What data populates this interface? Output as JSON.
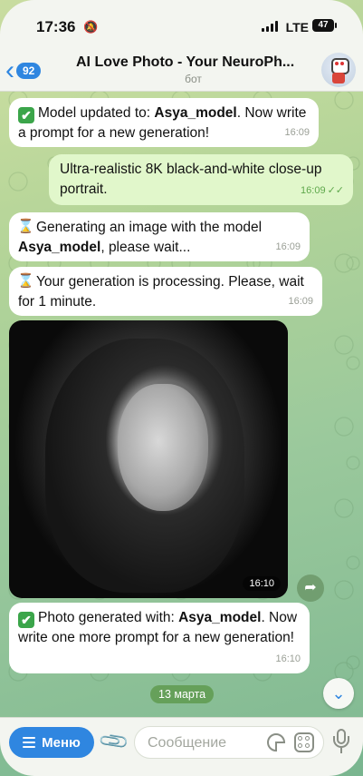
{
  "status": {
    "time": "17:36",
    "network": "LTE",
    "battery": "47"
  },
  "header": {
    "back_count": "92",
    "title": "AI Love Photo - Your NeuroPh...",
    "subtitle": "бот"
  },
  "messages": [
    {
      "type": "in",
      "emoji": "✔",
      "text_before": "Model updated to: ",
      "bold": "Asya_model",
      "text_after": ". Now write a prompt for a new generation!",
      "time": "16:09"
    },
    {
      "type": "out",
      "text": "Ultra-realistic 8K black-and-white close-up portrait.",
      "time": "16:09"
    },
    {
      "type": "in",
      "text_before": "Generating an image with the model ",
      "bold": "Asya_model",
      "text_after": ", please wait...",
      "time": "16:09"
    },
    {
      "type": "in",
      "text": "Your generation is processing. Please, wait for 1 minute.",
      "time": "16:09"
    },
    {
      "type": "photo",
      "time": "16:10"
    },
    {
      "type": "in",
      "emoji": "✔",
      "text_before": "Photo generated with: ",
      "bold": "Asya_model",
      "text_after": ". Now write one more prompt for a new generation!",
      "time": "16:10"
    }
  ],
  "date_pill": "13 марта",
  "input": {
    "menu_label": "Меню",
    "placeholder": "Сообщение"
  },
  "colors": {
    "accent": "#2f86e0",
    "outgoing_bubble": "#e1f7cb",
    "incoming_bubble": "#ffffff"
  }
}
